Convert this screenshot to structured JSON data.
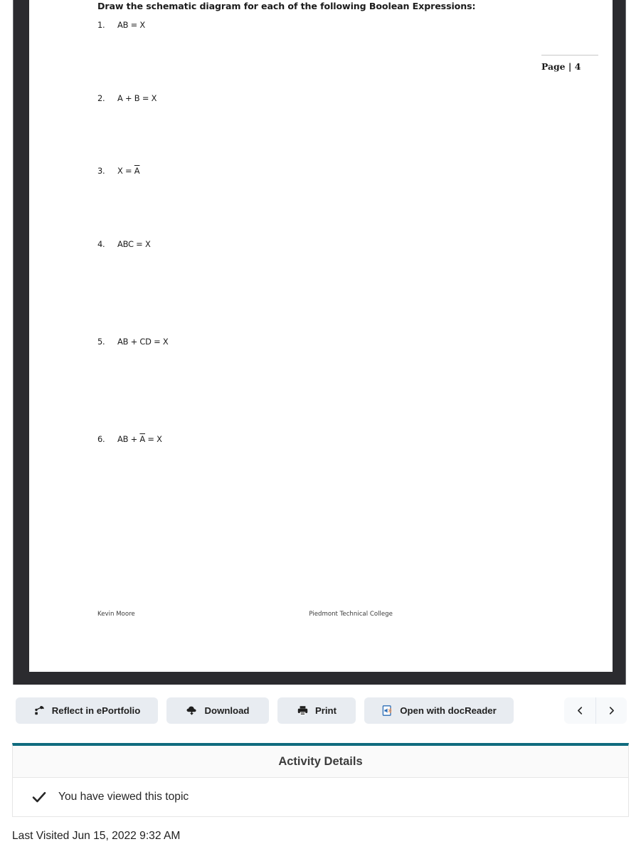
{
  "document": {
    "title": "Draw the schematic diagram for each of the following Boolean Expressions:",
    "questions": [
      {
        "number": "1.",
        "pre": "AB = X",
        "over": "",
        "post": ""
      },
      {
        "number": "2.",
        "pre": "A + B = X",
        "over": "",
        "post": ""
      },
      {
        "number": "3.",
        "pre": "X = ",
        "over": "A",
        "post": ""
      },
      {
        "number": "4.",
        "pre": "ABC = X",
        "over": "",
        "post": ""
      },
      {
        "number": "5.",
        "pre": "AB + CD = X",
        "over": "",
        "post": ""
      },
      {
        "number": "6.",
        "pre": "AB + ",
        "over": "A",
        "post": " = X"
      }
    ],
    "page_label": "Page | 4",
    "footer_left": "Kevin Moore",
    "footer_center": "Piedmont Technical College"
  },
  "toolbar": {
    "reflect_label": "Reflect in ePortfolio",
    "reflect_icon": "eportfolio-icon",
    "download_label": "Download",
    "download_icon": "download-cloud-icon",
    "print_label": "Print",
    "print_icon": "printer-icon",
    "docreader_label": "Open with docReader",
    "docreader_icon": "docreader-icon",
    "prev_icon": "chevron-left-icon",
    "next_icon": "chevron-right-icon"
  },
  "activity": {
    "header": "Activity Details",
    "status_text": "You have viewed this topic",
    "status_icon": "checkmark-icon"
  },
  "last_visited": "Last Visited Jun 15, 2022 9:32 AM",
  "colors": {
    "accent_teal": "#0f6b7e",
    "button_bg": "#e8ecf1",
    "viewer_frame": "#2b2b2f",
    "docreader_blue": "#2b6cb5"
  }
}
